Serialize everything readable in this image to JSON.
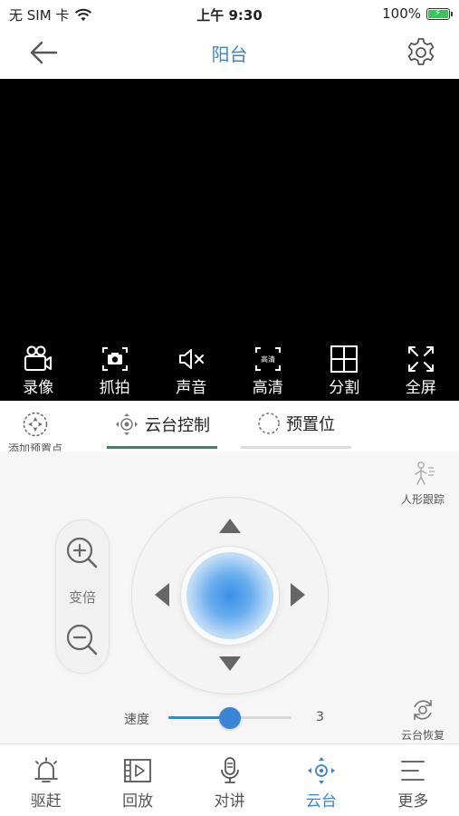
{
  "status_bar": {
    "carrier": "无 SIM 卡",
    "time": "上午 9:30",
    "battery": "100%",
    "battery_color": "#34c759"
  },
  "nav": {
    "title": "阳台",
    "back_icon": "arrow-left-icon",
    "settings_icon": "gear-icon"
  },
  "video_toolbar": [
    {
      "label": "录像",
      "icon": "video-camera-icon"
    },
    {
      "label": "抓拍",
      "icon": "snapshot-camera-icon"
    },
    {
      "label": "声音",
      "icon": "speaker-mute-icon"
    },
    {
      "label": "高清",
      "icon": "hd-frame-icon",
      "icon_text": "高清"
    },
    {
      "label": "分割",
      "icon": "grid-split-icon"
    },
    {
      "label": "全屏",
      "icon": "fullscreen-icon"
    }
  ],
  "tabs": {
    "add_preset": "添加预置点",
    "ptz": "云台控制",
    "preset": "预置位",
    "active": "ptz"
  },
  "controls": {
    "human_track": "人形跟踪",
    "zoom_label": "变倍",
    "speed_label": "速度",
    "speed_value": "3",
    "speed_fraction": 0.5,
    "ptz_restore": "云台恢复"
  },
  "bottom_tabs": [
    {
      "label": "驱赶",
      "icon": "alarm-bell-icon"
    },
    {
      "label": "回放",
      "icon": "playback-film-icon"
    },
    {
      "label": "对讲",
      "icon": "microphone-icon"
    },
    {
      "label": "云台",
      "icon": "ptz-icon",
      "active": true
    },
    {
      "label": "更多",
      "icon": "more-lines-icon"
    }
  ],
  "colors": {
    "accent": "#3a86d4",
    "tab_underline_active": "#4f7a63",
    "video_bg": "#000000"
  }
}
